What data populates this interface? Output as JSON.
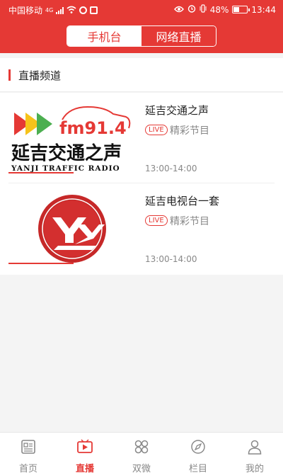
{
  "status": {
    "carrier": "中国移动",
    "network": "4G",
    "battery": "48%",
    "battery_level": 0.48,
    "time": "13:44"
  },
  "header": {
    "tabs": [
      {
        "label": "手机台",
        "active": true
      },
      {
        "label": "网络直播",
        "active": false
      }
    ]
  },
  "section": {
    "title": "直播频道"
  },
  "channels": [
    {
      "name": "延吉交通之声",
      "live_badge": "LIVE",
      "program": "精彩节目",
      "time": "13:00-14:00",
      "logo_text_main": "延吉交通之声",
      "logo_text_fm": "fm91.4",
      "logo_text_en": "YANJI TRAFFIC RADIO"
    },
    {
      "name": "延吉电视台一套",
      "live_badge": "LIVE",
      "program": "精彩节目",
      "time": "13:00-14:00"
    }
  ],
  "tabbar": [
    {
      "label": "首页",
      "icon": "news-icon",
      "active": false
    },
    {
      "label": "直播",
      "icon": "live-play-icon",
      "active": true
    },
    {
      "label": "双微",
      "icon": "grid-icon",
      "active": false
    },
    {
      "label": "栏目",
      "icon": "compass-icon",
      "active": false
    },
    {
      "label": "我的",
      "icon": "user-icon",
      "active": false
    }
  ],
  "colors": {
    "accent": "#e53935"
  }
}
